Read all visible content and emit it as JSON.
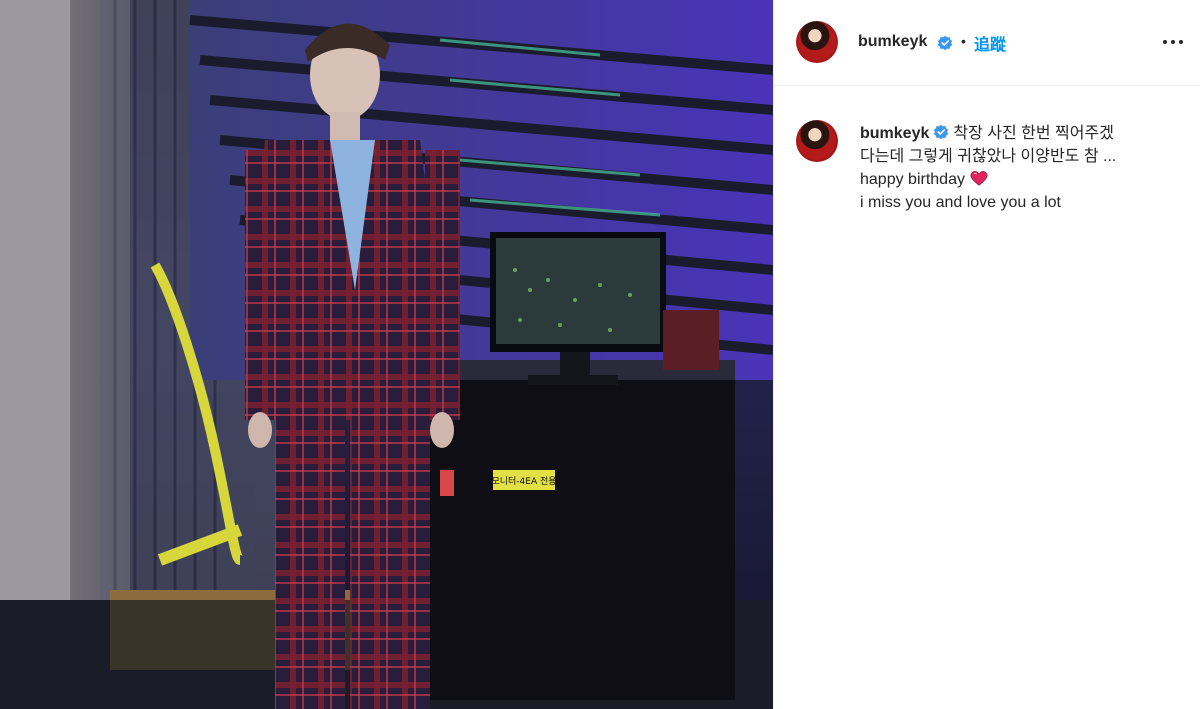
{
  "post": {
    "username": "bumkeyk",
    "follow_label": "追蹤",
    "separator": "•",
    "more_icon": "more-horizontal-icon",
    "verified_icon": "verified-badge-icon",
    "photo": {
      "sticker_text": "모니터-4EA 전용"
    },
    "caption": {
      "username": "bumkeyk",
      "lines": [
        "착장 사진 한번 찍어주겠",
        "다는데 그렇게 귀찮았나 이양반도 참 ...",
        "happy birthday",
        "i miss you and love you a lot"
      ],
      "emoji": "heart-icon"
    }
  },
  "colors": {
    "accent": "#0095f6",
    "verified": "#3897f0",
    "heart": "#e0245e",
    "text": "#262626"
  }
}
